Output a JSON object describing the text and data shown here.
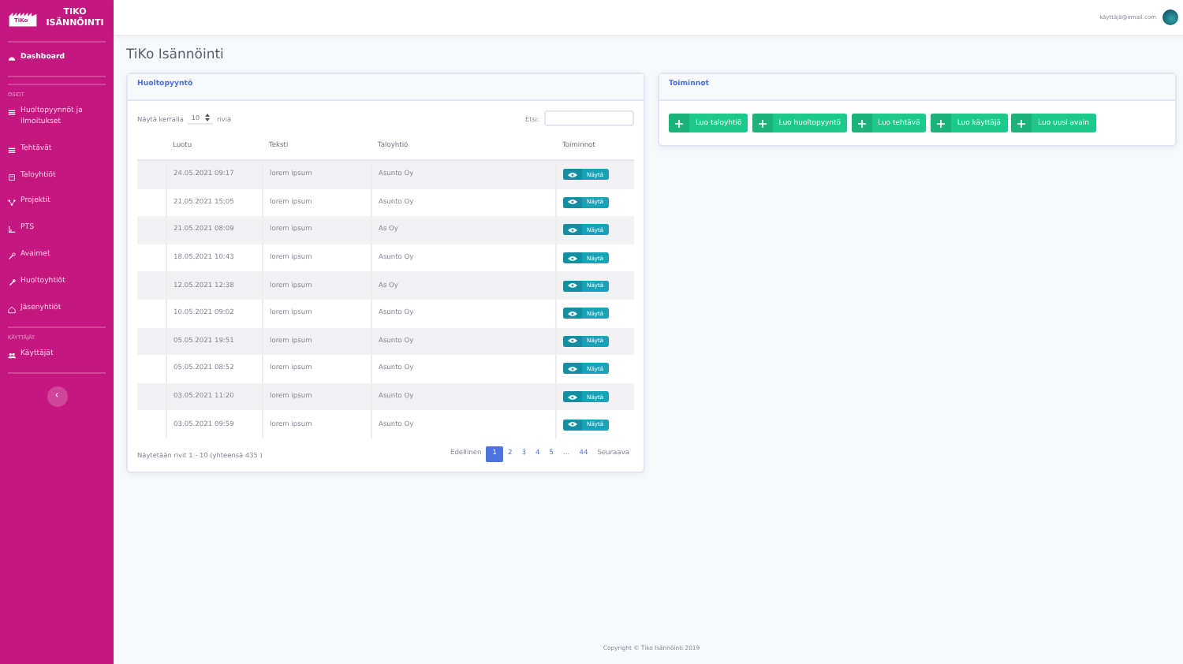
{
  "brand": {
    "logo_text": "TiKo",
    "title": "TIKO ISÄNNÖINTI"
  },
  "sidebar": {
    "items": [
      {
        "kind": "link",
        "label": "Dashboard",
        "selected": true
      },
      {
        "kind": "heading",
        "label": "OSIOT"
      },
      {
        "kind": "link",
        "label": "Huoltopyynnöt ja ilmoitukset",
        "selected": false
      },
      {
        "kind": "link",
        "label": "Tehtävät",
        "selected": false
      },
      {
        "kind": "link",
        "label": "Taloyhtiöt",
        "selected": false
      },
      {
        "kind": "link",
        "label": "Projektit",
        "selected": false
      },
      {
        "kind": "link",
        "label": "PTS",
        "selected": false
      },
      {
        "kind": "link",
        "label": "Avaimet",
        "selected": false
      },
      {
        "kind": "link",
        "label": "Huoltoyhtiöt",
        "selected": false
      },
      {
        "kind": "link",
        "label": "Jäsenyhtiöt",
        "selected": false
      },
      {
        "kind": "heading",
        "label": "KÄYTTÄJÄT"
      },
      {
        "kind": "link",
        "label": "Käyttäjät",
        "selected": false
      }
    ],
    "toggle": "‹"
  },
  "topbar": {
    "email": "käyttäjä@email.com"
  },
  "page_title": "TiKo Isännöinti",
  "requests_card": {
    "title": "Huoltopyyntö",
    "length_label_before": "Näytä kerralla",
    "length_value": "10",
    "length_label_after": "riviä",
    "search_label": "Etsi:",
    "columns": [
      "",
      "Luotu",
      "Teksti",
      "Taloyhtiö",
      "Toiminnot"
    ],
    "rows": [
      {
        "created": "24.05.2021 09:17",
        "text": "lorem ipsum",
        "company": "Asunto Oy",
        "action": "Näytä"
      },
      {
        "created": "21.05.2021 15:05",
        "text": "lorem ipsum",
        "company": "Asunto Oy",
        "action": "Näytä"
      },
      {
        "created": "21.05.2021 08:09",
        "text": "lorem ipsum",
        "company": "As Oy",
        "action": "Näytä"
      },
      {
        "created": "18.05.2021 10:43",
        "text": "lorem ipsum",
        "company": "Asunto Oy",
        "action": "Näytä"
      },
      {
        "created": "12.05.2021 12:38",
        "text": "lorem ipsum",
        "company": "As Oy",
        "action": "Näytä"
      },
      {
        "created": "10.05.2021 09:02",
        "text": "lorem ipsum",
        "company": "Asunto Oy",
        "action": "Näytä"
      },
      {
        "created": "05.05.2021 19:51",
        "text": "lorem ipsum",
        "company": "Asunto Oy",
        "action": "Näytä"
      },
      {
        "created": "05.05.2021 08:52",
        "text": "lorem ipsum",
        "company": "Asunto Oy",
        "action": "Näytä"
      },
      {
        "created": "03.05.2021 11:20",
        "text": "lorem ipsum",
        "company": "Asunto Oy",
        "action": "Näytä"
      },
      {
        "created": "03.05.2021 09:59",
        "text": "lorem ipsum",
        "company": "Asunto Oy",
        "action": "Näytä"
      }
    ],
    "info": "Näytetään rivit 1 - 10 (yhteensä 435 )",
    "pagination": [
      {
        "kind": "text",
        "label": "Edellinen",
        "selected": false
      },
      {
        "kind": "page",
        "label": "1",
        "selected": true
      },
      {
        "kind": "page",
        "label": "2",
        "selected": false
      },
      {
        "kind": "page",
        "label": "3",
        "selected": false
      },
      {
        "kind": "page",
        "label": "4",
        "selected": false
      },
      {
        "kind": "page",
        "label": "5",
        "selected": false
      },
      {
        "kind": "ellipsis",
        "label": "…",
        "selected": false
      },
      {
        "kind": "page",
        "label": "44",
        "selected": false
      },
      {
        "kind": "text",
        "label": "Seuraava",
        "selected": false
      }
    ]
  },
  "actions_card": {
    "title": "Toiminnot",
    "buttons": [
      "Luo taloyhtiö",
      "Luo huoltopyyntö",
      "Luo tehtävä",
      "Luo käyttäjä",
      "Luo uusi avain"
    ]
  },
  "footer": "Copyright © Tiko Isännöinti 2019"
}
